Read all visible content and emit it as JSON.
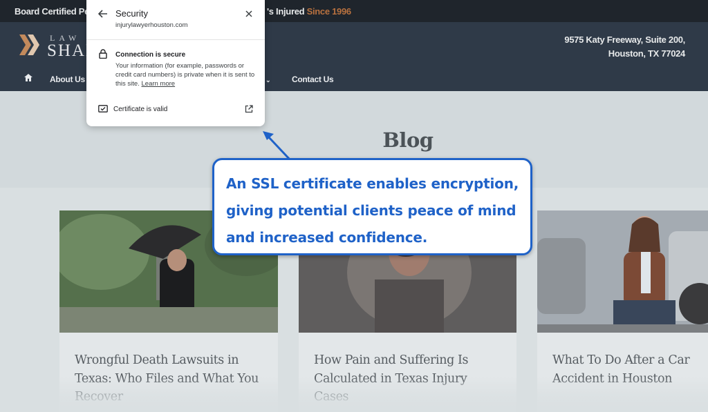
{
  "topbar": {
    "left_text": "Board Certified Pe",
    "right_text": "'s Injured",
    "right_accent": "Since 1996"
  },
  "header": {
    "logo_top": "LAW O",
    "logo_main": "SHAN",
    "address_line1": "9575 Katy Freeway, Suite 200,",
    "address_line2": "Houston, TX 77024",
    "nav": [
      {
        "label": "About Us"
      },
      {
        "label": "Contact Us"
      }
    ]
  },
  "main": {
    "page_title": "Blog",
    "posts": [
      {
        "title": "Wrongful Death Lawsuits in Texas: Who Files and What You Recover"
      },
      {
        "title": "How Pain and Suffering Is Calculated in Texas Injury Cases"
      },
      {
        "title": "What To Do After a Car Accident in Houston"
      }
    ]
  },
  "security_popup": {
    "title": "Security",
    "domain": "injurylawyerhouston.com",
    "connection_heading": "Connection is secure",
    "connection_info": "Your information (for example, passwords or credit card numbers) is private when it is sent to this site.",
    "learn_more": "Learn more",
    "certificate": "Certificate is valid"
  },
  "callout": {
    "text": "An SSL certificate enables encryption, giving potential clients peace of mind and increased confidence.",
    "color": "#1f62c8"
  }
}
